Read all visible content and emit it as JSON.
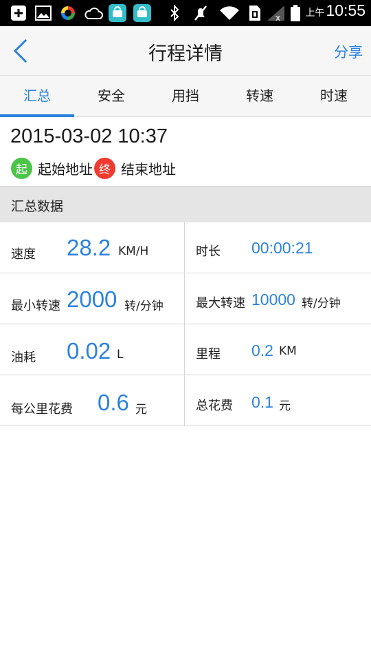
{
  "status_bar": {
    "icons": [
      "add-box-icon",
      "image-icon",
      "colorful-app-icon",
      "cloud-icon",
      "huawei-app-icon",
      "huawei-app-icon",
      "bluetooth-icon",
      "mute-icon",
      "wifi-icon",
      "sim-icon",
      "signal-icon",
      "battery-icon"
    ],
    "ampm": "上午",
    "time": "10:55"
  },
  "header": {
    "title": "行程详情",
    "share_label": "分享"
  },
  "tabs": [
    {
      "label": "汇总",
      "active": true
    },
    {
      "label": "安全",
      "active": false
    },
    {
      "label": "用挡",
      "active": false
    },
    {
      "label": "转速",
      "active": false
    },
    {
      "label": "时速",
      "active": false
    }
  ],
  "trip": {
    "datetime": "2015-03-02 10:37",
    "start_badge": "起",
    "start_address": "起始地址",
    "end_badge": "终",
    "end_address": "结束地址"
  },
  "summary": {
    "section_title": "汇总数据",
    "rows": [
      {
        "left": {
          "label": "速度",
          "value": "28.2",
          "unit": "KM/H"
        },
        "right": {
          "label": "时长",
          "value": "00:00:21",
          "unit": ""
        }
      },
      {
        "left": {
          "label": "最小转速",
          "value": "2000",
          "unit": "转/分钟"
        },
        "right": {
          "label": "最大转速",
          "value": "10000",
          "unit": "转/分钟"
        }
      },
      {
        "left": {
          "label": "油耗",
          "value": "0.02",
          "unit": "L"
        },
        "right": {
          "label": "里程",
          "value": "0.2",
          "unit": "KM"
        }
      },
      {
        "left": {
          "label": "每公里花费",
          "value": "0.6",
          "unit": "元"
        },
        "right": {
          "label": "总花费",
          "value": "0.1",
          "unit": "元"
        }
      }
    ]
  },
  "colors": {
    "accent": "#2b82e0",
    "start_badge": "#4cc44a",
    "end_badge": "#ef3b2f"
  }
}
